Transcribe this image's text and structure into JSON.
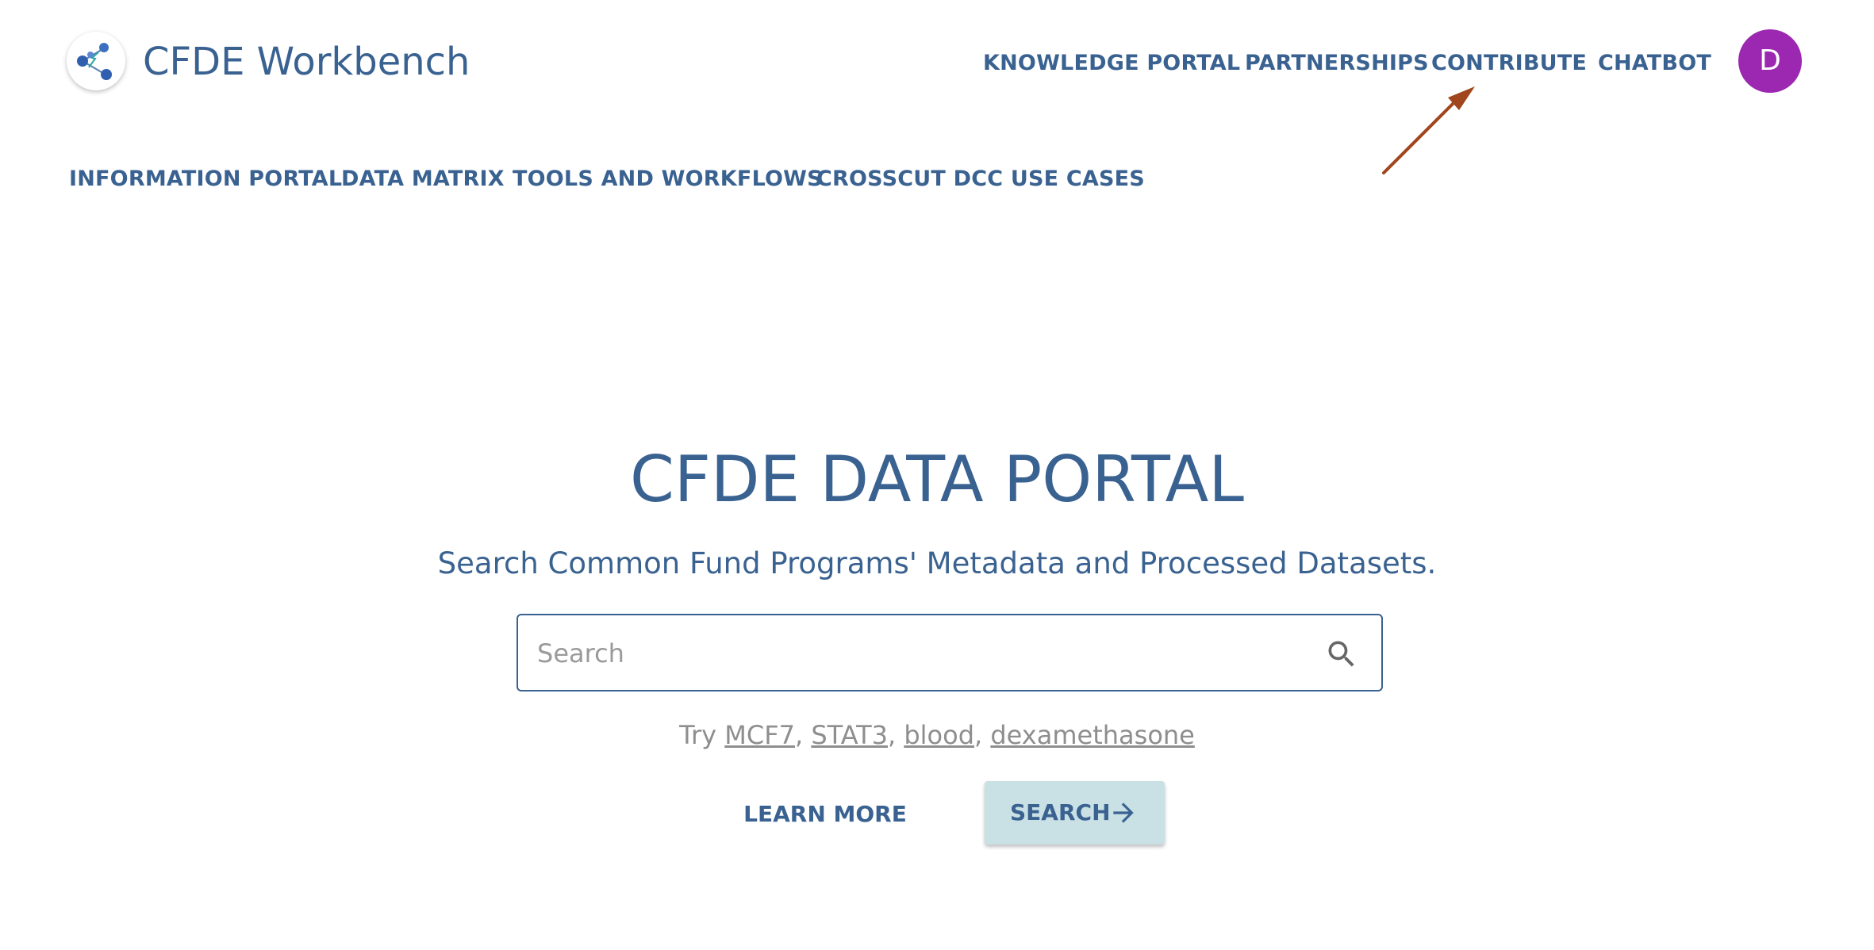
{
  "header": {
    "brand_name": "CFDE Workbench",
    "nav_top": [
      {
        "label": "KNOWLEDGE PORTAL"
      },
      {
        "label": "PARTNERSHIPS"
      },
      {
        "label": "CONTRIBUTE"
      },
      {
        "label": "CHATBOT"
      }
    ],
    "avatar_initial": "D",
    "avatar_color": "#9c27b0"
  },
  "subnav": [
    {
      "label": "INFORMATION PORTAL"
    },
    {
      "label": "DATA MATRIX"
    },
    {
      "label": "TOOLS AND WORKFLOWS"
    },
    {
      "label": "CROSSCUT DCC USE CASES"
    }
  ],
  "hero": {
    "title": "CFDE DATA PORTAL",
    "subtitle": "Search Common Fund Programs' Metadata and Processed Datasets."
  },
  "search": {
    "placeholder": "Search",
    "value": "",
    "try_prefix": "Try",
    "examples": [
      "MCF7",
      "STAT3",
      "blood",
      "dexamethasone"
    ],
    "separator": ","
  },
  "actions": {
    "learn_more_label": "LEARN MORE",
    "search_label": "SEARCH"
  },
  "annotation": {
    "arrow_color": "#a0451c",
    "icon": "annotation-arrow"
  },
  "colors": {
    "primary": "#3a6291",
    "button_bg": "#c9e0e4",
    "muted_text": "#8e8e8e"
  }
}
